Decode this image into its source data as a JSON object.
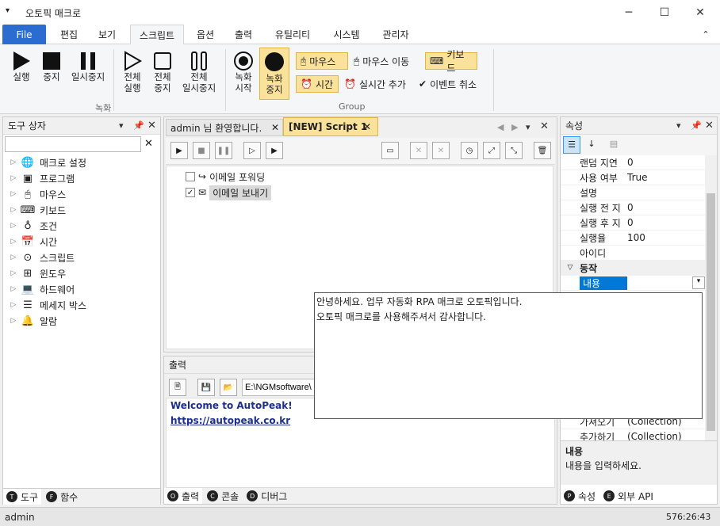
{
  "window": {
    "title": "오토픽 매크로",
    "qa_icon": "▾",
    "min": "─",
    "max": "☐",
    "close": "✕"
  },
  "menu": {
    "file": "File",
    "tabs": [
      "편집",
      "보기",
      "스크립트",
      "옵션",
      "출력",
      "유틸리티",
      "시스템",
      "관리자"
    ],
    "collapse": "⌃"
  },
  "ribbon": {
    "run": "실행",
    "stop": "중지",
    "pause": "일시중지",
    "run_all": [
      "전체",
      "실행"
    ],
    "stop_all": [
      "전체",
      "중지"
    ],
    "pause_all": [
      "전체",
      "일시중지"
    ],
    "rec_start": [
      "녹화",
      "시작"
    ],
    "rec_stop": [
      "녹화",
      "중지"
    ],
    "group_record": "녹화",
    "group_group": "Group",
    "mouse": "마우스",
    "mouse_move": "마우스 이동",
    "keyboard": "키보드",
    "time": "시간",
    "realtime_add": "실시간 추가",
    "event_cancel": "이벤트 취소",
    "accent": "#fbe29b"
  },
  "toolbox": {
    "title": "도구 상자",
    "search_placeholder": "",
    "items": [
      {
        "label": "매크로 설정",
        "icon": "globe-icon"
      },
      {
        "label": "프로그램",
        "icon": "program-icon"
      },
      {
        "label": "마우스",
        "icon": "mouse-icon"
      },
      {
        "label": "키보드",
        "icon": "keyboard-icon"
      },
      {
        "label": "조건",
        "icon": "condition-icon"
      },
      {
        "label": "시간",
        "icon": "calendar-icon"
      },
      {
        "label": "스크립트",
        "icon": "script-icon"
      },
      {
        "label": "윈도우",
        "icon": "windows-icon"
      },
      {
        "label": "하드웨어",
        "icon": "laptop-icon"
      },
      {
        "label": "메세지 박스",
        "icon": "message-icon"
      },
      {
        "label": "알람",
        "icon": "bell-icon"
      }
    ],
    "tabs": [
      {
        "letter": "T",
        "label": "도구"
      },
      {
        "letter": "F",
        "label": "함수"
      }
    ]
  },
  "editor": {
    "tabs": [
      {
        "label": "admin 님 환영합니다.",
        "active": false
      },
      {
        "label": "[NEW] Script 1",
        "active": true
      }
    ],
    "steps": [
      {
        "label": "이메일 포워딩",
        "checked": false
      },
      {
        "label": "이메일 보내기",
        "checked": true
      }
    ]
  },
  "output": {
    "title": "출력",
    "path": "E:\\NGMsoftware\\",
    "lines": [
      "Welcome to AutoPeak!",
      "https://autopeak.co.kr"
    ],
    "tabs": [
      {
        "letter": "O",
        "label": "출력"
      },
      {
        "letter": "C",
        "label": "콘솔"
      },
      {
        "letter": "D",
        "label": "디버그"
      }
    ]
  },
  "popup": {
    "lines": [
      "안녕하세요. 업무 자동화 RPA 매크로 오토픽입니다.",
      "오토픽 매크로를 사용해주셔서 감사합니다."
    ]
  },
  "properties": {
    "title": "속성",
    "rows": [
      {
        "k": "랜덤 지연",
        "v": "0"
      },
      {
        "k": "사용 여부",
        "v": "True"
      },
      {
        "k": "설명",
        "v": ""
      },
      {
        "k": "실행 전 지",
        "v": "0"
      },
      {
        "k": "실행 후 지",
        "v": "0"
      },
      {
        "k": "실행율",
        "v": "100"
      },
      {
        "k": "아이디",
        "v": ""
      }
    ],
    "category": "동작",
    "selected": "내용",
    "bottom_rows": [
      {
        "k": "가져오기",
        "v": "(Collection)"
      },
      {
        "k": "추가하기",
        "v": "(Collection)"
      }
    ],
    "desc_title": "내용",
    "desc_text": "내용을 입력하세요.",
    "tabs": [
      {
        "letter": "P",
        "label": "속성"
      },
      {
        "letter": "E",
        "label": "외부 API"
      }
    ]
  },
  "status": {
    "user": "admin",
    "time": "576:26:43"
  }
}
